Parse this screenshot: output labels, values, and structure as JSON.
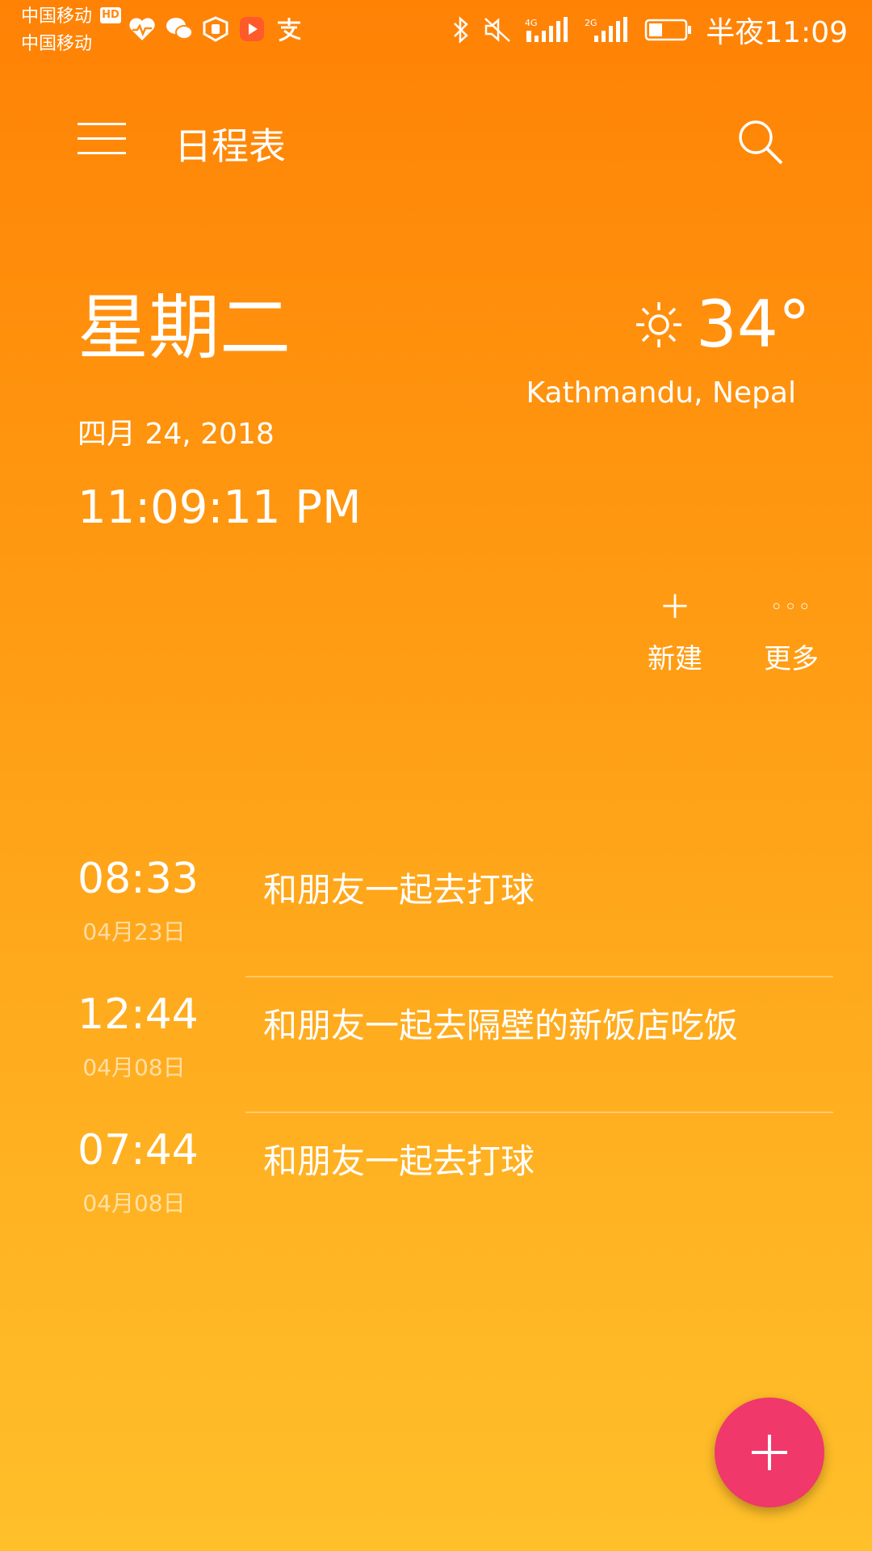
{
  "status_bar": {
    "carrier_1": "中国移动",
    "carrier_2": "中国移动",
    "hd_badge": "HD",
    "network_1": "4G",
    "network_2": "2G",
    "clock": "半夜11:09"
  },
  "app_bar": {
    "title": "日程表",
    "menu_icon": "menu-icon",
    "search_icon": "search-icon"
  },
  "date_panel": {
    "weekday": "星期二",
    "date": "四月 24, 2018",
    "time": "11:09:11 PM"
  },
  "weather": {
    "icon": "sun-icon",
    "temperature": "34°",
    "location": "Kathmandu, Nepal"
  },
  "actions": {
    "new_label": "新建",
    "more_label": "更多",
    "new_icon": "＋",
    "more_icon": "◦◦◦"
  },
  "schedule": [
    {
      "time": "08:33",
      "date": "04月23日",
      "title": "和朋友一起去打球"
    },
    {
      "time": "12:44",
      "date": "04月08日",
      "title": "和朋友一起去隔壁的新饭店吃饭"
    },
    {
      "time": "07:44",
      "date": "04月08日",
      "title": "和朋友一起去打球"
    }
  ],
  "colors": {
    "background_top": "#ff8205",
    "background_bottom": "#ffc02a",
    "fab": "#f0386a"
  }
}
